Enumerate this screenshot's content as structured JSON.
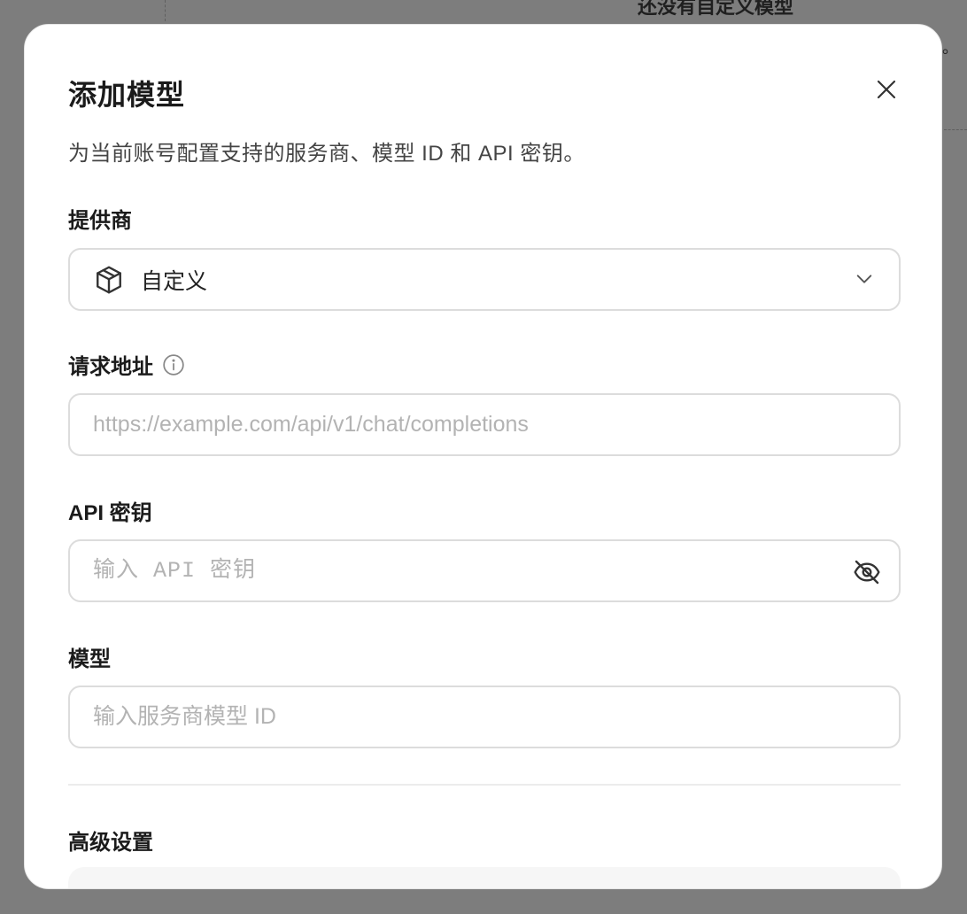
{
  "background": {
    "title": "还没有自定义模型",
    "trailing_mark": "。"
  },
  "modal": {
    "title": "添加模型",
    "description": "为当前账号配置支持的服务商、模型 ID 和 API 密钥。",
    "provider": {
      "label": "提供商",
      "selected": "自定义",
      "icon": "cube-icon"
    },
    "endpoint": {
      "label": "请求地址",
      "value": "",
      "placeholder": "https://example.com/api/v1/chat/completions"
    },
    "api_key": {
      "label": "API 密钥",
      "value": "",
      "placeholder": "输入 API 密钥"
    },
    "model": {
      "label": "模型",
      "value": "",
      "placeholder": "输入服务商模型 ID"
    },
    "advanced": {
      "label": "高级设置"
    }
  },
  "colors": {
    "overlay": "#7d7d7d",
    "modal_bg": "#ffffff",
    "border": "#dcdcdc",
    "placeholder": "#b3b3b3",
    "text": "#1b1b1b"
  }
}
